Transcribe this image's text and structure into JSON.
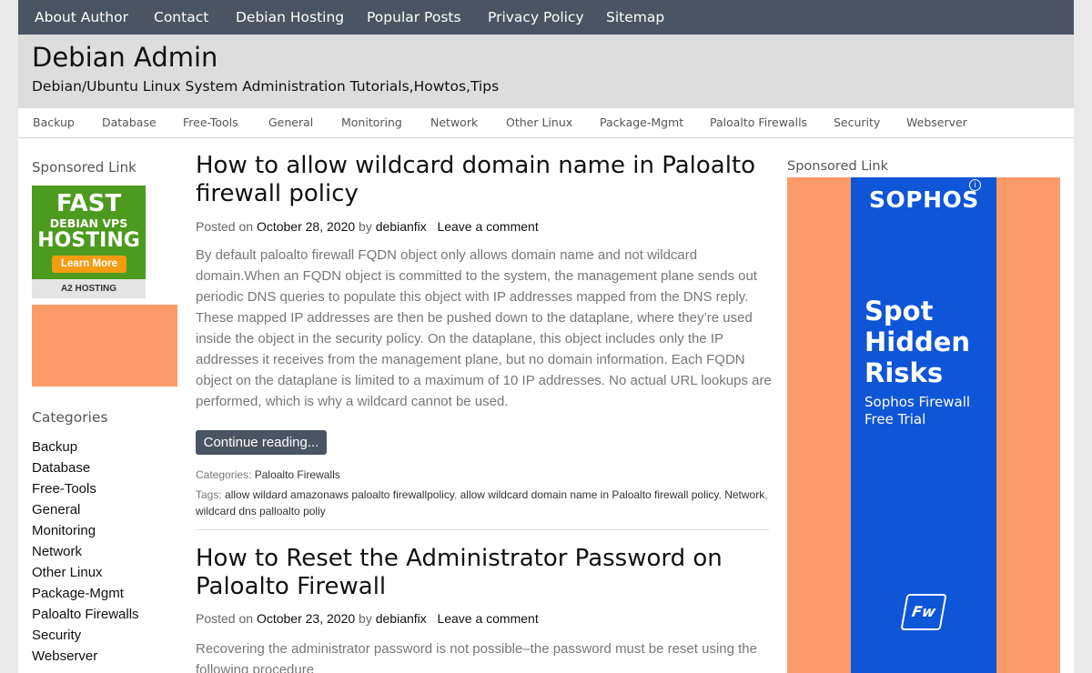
{
  "top_nav": [
    "About Author",
    "Contact",
    "Debian Hosting",
    "Popular Posts",
    "Privacy Policy",
    "Sitemap"
  ],
  "site": {
    "title": "Debian Admin",
    "description": "Debian/Ubuntu Linux System Administration Tutorials,Howtos,Tips"
  },
  "category_nav": [
    "Backup",
    "Database",
    "Free-Tools",
    "General",
    "Monitoring",
    "Network",
    "Other Linux",
    "Package-Mgmt",
    "Paloalto Firewalls",
    "Security",
    "Webserver"
  ],
  "left_sidebar": {
    "sponsored_title": "Sponsored Link",
    "ad": {
      "line1": "FAST",
      "line2": "DEBIAN VPS",
      "line3": "HOSTING",
      "button": "Learn More",
      "footer": "A2 HOSTING",
      "color": "#4c9a1e"
    },
    "categories_title": "Categories",
    "categories": [
      "Backup",
      "Database",
      "Free-Tools",
      "General",
      "Monitoring",
      "Network",
      "Other Linux",
      "Package-Mgmt",
      "Paloalto Firewalls",
      "Security",
      "Webserver"
    ]
  },
  "posts": [
    {
      "title": "How to allow wildcard domain name in Paloalto firewall policy",
      "posted_on_label": "Posted on",
      "date": "October 28, 2020",
      "by_label": "by",
      "author": "debianfix",
      "comment_link": "Leave a comment",
      "excerpt": "By default paloalto firewall FQDN object only allows domain name and not wildcard domain.When an FQDN object is committed to the system, the management plane sends out periodic DNS queries to populate this object with IP addresses mapped from the DNS reply. These mapped IP addresses are then be pushed down to the dataplane, where they’re used inside the object in the security policy. On the dataplane, this object includes only the IP addresses it receives from the management plane, but no domain information. Each FQDN object on the dataplane is limited to a maximum of 10 IP addresses. No actual URL lookups are performed, which is why a wildcard cannot be used.",
      "continue_label": "Continue reading...",
      "categories_label": "Categories:",
      "category": "Paloalto Firewalls",
      "tags_label": "Tags:",
      "tags": [
        "allow wildard amazonaws paloalto firewallpolicy",
        "allow wildcard domain name in Paloalto firewall policy",
        "Network",
        "wildcard dns palloalto poliy"
      ]
    },
    {
      "title": "How to Reset the Administrator Password on Paloalto Firewall",
      "posted_on_label": "Posted on",
      "date": "October 23, 2020",
      "by_label": "by",
      "author": "debianfix",
      "comment_link": "Leave a comment",
      "excerpt": "Recovering the administrator password is not possible–the password must be reset using the following procedure"
    }
  ],
  "right_sidebar": {
    "sponsored_title": "Sponsored Link",
    "ad": {
      "logo": "SOPHOS",
      "info_glyph": "i",
      "headline_lines": [
        "Spot",
        "Hidden",
        "Risks"
      ],
      "sub_lines": [
        "Sophos Firewall",
        "Free Trial"
      ],
      "badge": "Fw",
      "color_bg": "#fd9a69",
      "color_panel": "#0e55d8"
    }
  },
  "colors": {
    "nav_bg": "#4a5462",
    "header_bg": "#dddddd",
    "ad_orange": "#fd9a69"
  }
}
